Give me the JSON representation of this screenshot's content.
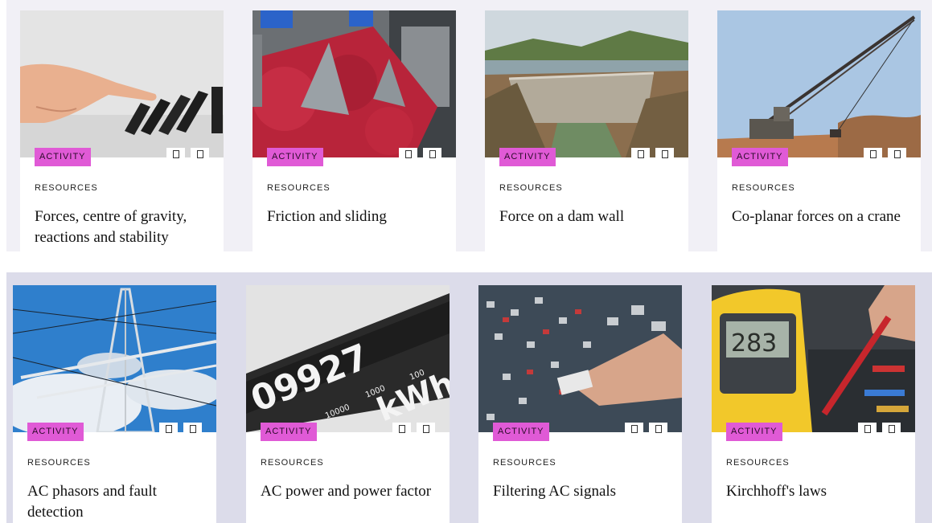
{
  "cards": [
    {
      "badge": "ACTIVITY",
      "category": "RESOURCES",
      "title": "Forces, centre of gravity, reactions and stability",
      "image": "hand-dominoes"
    },
    {
      "badge": "ACTIVITY",
      "category": "RESOURCES",
      "title": "Friction and sliding",
      "image": "red-pellets-conveyor"
    },
    {
      "badge": "ACTIVITY",
      "category": "RESOURCES",
      "title": "Force on a dam wall",
      "image": "dam-wall"
    },
    {
      "badge": "ACTIVITY",
      "category": "RESOURCES",
      "title": "Co-planar forces on a crane",
      "image": "dragline-crane"
    },
    {
      "badge": "ACTIVITY",
      "category": "RESOURCES",
      "title": "AC phasors and fault detection",
      "image": "power-pylon"
    },
    {
      "badge": "ACTIVITY",
      "category": "RESOURCES",
      "title": "AC power and power factor",
      "image": "kwh-meter"
    },
    {
      "badge": "ACTIVITY",
      "category": "RESOURCES",
      "title": "Filtering AC signals",
      "image": "mixing-desk"
    },
    {
      "badge": "ACTIVITY",
      "category": "RESOURCES",
      "title": "Kirchhoff's laws",
      "image": "multimeter"
    }
  ],
  "meter_text": {
    "digits": "09927",
    "unit": "kWh",
    "small1": "10000",
    "small2": "1000",
    "small3": "100"
  },
  "multimeter_text": {
    "reading": "283"
  },
  "colors": {
    "badge": "#e05ad6",
    "band_top": "#f1f0f6",
    "band_bottom": "#dcdcea"
  }
}
